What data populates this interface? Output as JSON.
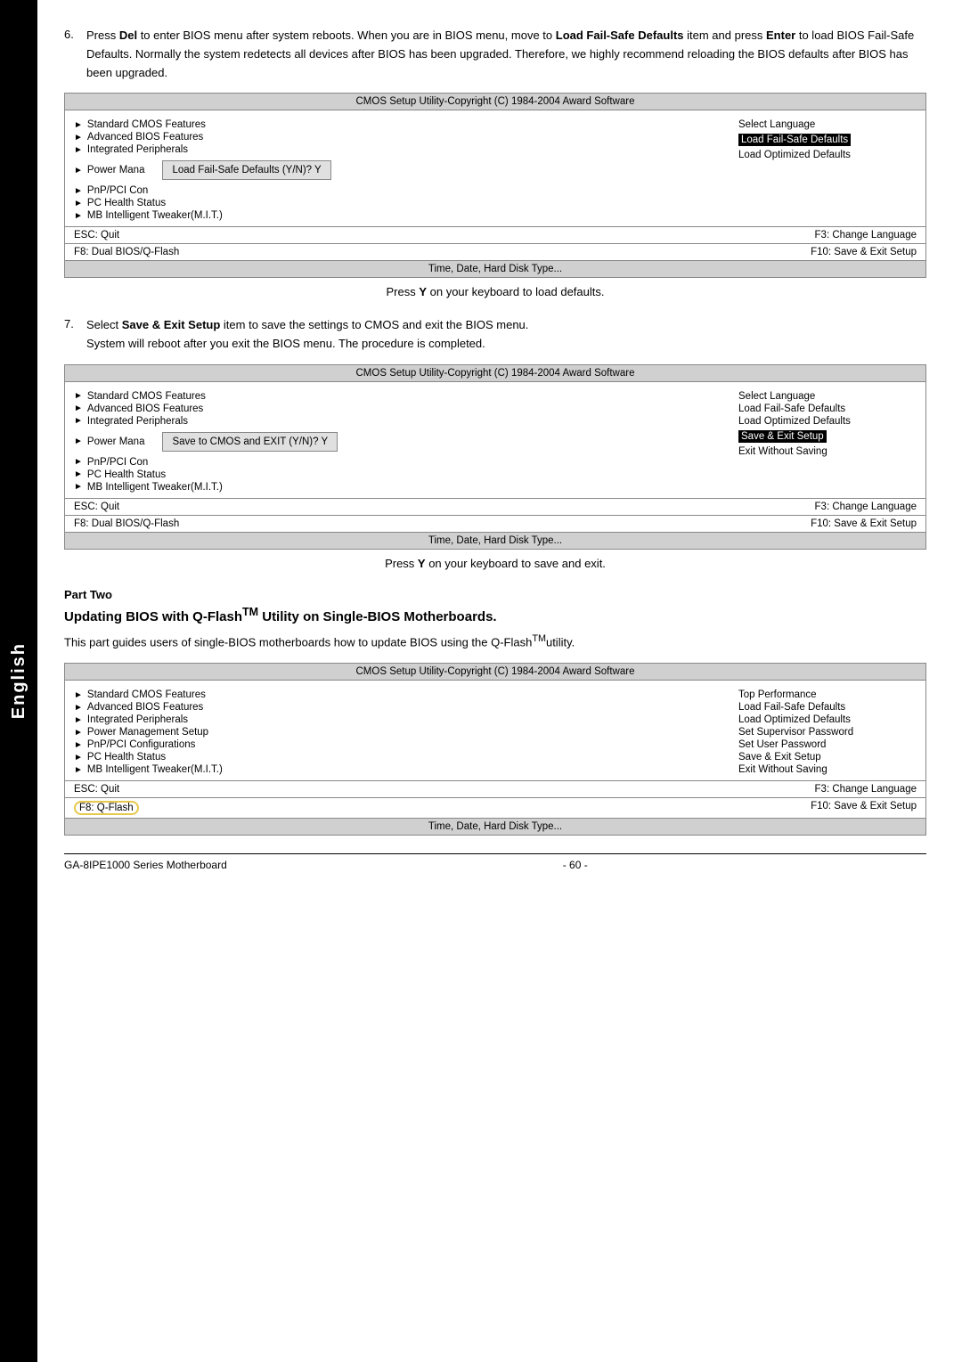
{
  "side_tab": {
    "label": "English"
  },
  "step6": {
    "number": "6.",
    "text_parts": [
      "Press ",
      "Del",
      " to enter BIOS menu after system reboots. When you are in BIOS menu, move to ",
      "Load Fail-Safe Defaults",
      " item and press ",
      "Enter",
      " to load BIOS Fail-Safe Defaults. Normally the system redetects all devices after BIOS has been upgraded. Therefore, we highly recommend reloading the BIOS defaults after BIOS has been upgraded."
    ]
  },
  "bios1": {
    "title": "CMOS Setup Utility-Copyright (C) 1984-2004 Award Software",
    "left_items": [
      "Standard CMOS Features",
      "Advanced BIOS Features",
      "Integrated Peripherals",
      "Power Mana",
      "PnP/PCI Con",
      "PC Health Status",
      "MB Intelligent Tweaker(M.I.T.)"
    ],
    "right_items": [
      "Select Language",
      "Load Fail-Safe Defaults",
      "Load Optimized Defaults"
    ],
    "dialog": "Load Fail-Safe Defaults (Y/N)? Y",
    "bottom_left1": "ESC: Quit",
    "bottom_right1": "F3: Change Language",
    "bottom_left2": "F8: Dual BIOS/Q-Flash",
    "bottom_right2": "F10: Save & Exit Setup",
    "footer": "Time, Date, Hard Disk Type..."
  },
  "caption1": {
    "text": "Press ",
    "bold": "Y",
    "text2": " on your keyboard to load defaults."
  },
  "step7": {
    "number": "7.",
    "text_parts": [
      "Select ",
      "Save & Exit Setup",
      " item to save the settings to CMOS and exit the BIOS menu.",
      "\nSystem will reboot after you exit the BIOS menu. The procedure is completed."
    ]
  },
  "bios2": {
    "title": "CMOS Setup Utility-Copyright (C) 1984-2004 Award Software",
    "left_items": [
      "Standard CMOS Features",
      "Advanced BIOS Features",
      "Integrated Peripherals",
      "Power Mana",
      "PnP/PCI Con",
      "PC Health Status",
      "MB Intelligent Tweaker(M.I.T.)"
    ],
    "right_items_plain": [
      "Select Language",
      "Load Fail-Safe Defaults",
      "Load Optimized Defaults"
    ],
    "right_items_highlighted": [
      "Save & Exit Setup"
    ],
    "right_items_plain2": [
      "Exit Without Saving"
    ],
    "dialog": "Save to CMOS and EXIT (Y/N)? Y",
    "bottom_left1": "ESC: Quit",
    "bottom_right1": "F3: Change Language",
    "bottom_left2": "F8: Dual BIOS/Q-Flash",
    "bottom_right2": "F10: Save & Exit Setup",
    "footer": "Time, Date, Hard Disk Type..."
  },
  "caption2": {
    "text": "Press ",
    "bold": "Y",
    "text2": " on your keyboard to save and exit."
  },
  "part_two": {
    "label": "Part Two",
    "title": "Updating BIOS with Q-Flash",
    "tm": "TM",
    "title2": " Utility on Single-BIOS Motherboards.",
    "desc": "This part guides users of single-BIOS motherboards how to update BIOS using the Q-Flash",
    "tm2": "TM",
    "desc2": "utility."
  },
  "bios3": {
    "title": "CMOS Setup Utility-Copyright (C) 1984-2004 Award Software",
    "left_items": [
      "Standard CMOS Features",
      "Advanced BIOS Features",
      "Integrated Peripherals",
      "Power Management Setup",
      "PnP/PCI Configurations",
      "PC Health Status",
      "MB Intelligent Tweaker(M.I.T.)"
    ],
    "right_items": [
      "Top Performance",
      "Load Fail-Safe Defaults",
      "Load Optimized Defaults",
      "Set Supervisor Password",
      "Set User Password",
      "Save & Exit Setup",
      "Exit Without Saving"
    ],
    "bottom_left1": "ESC: Quit",
    "bottom_right1": "F3: Change Language",
    "bottom_left2_highlighted": "F8: Q-Flash",
    "bottom_right2": "F10: Save & Exit Setup",
    "footer": "Time, Date, Hard Disk Type..."
  },
  "footer": {
    "left": "GA-8IPE1000 Series Motherboard",
    "center": "- 60 -",
    "right": ""
  }
}
